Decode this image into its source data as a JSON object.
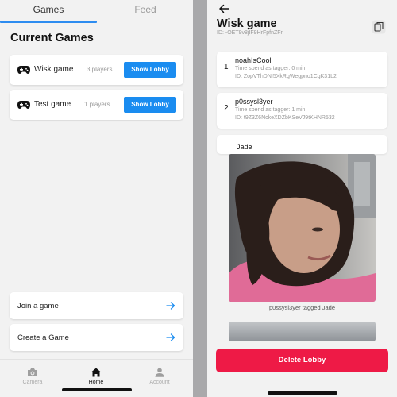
{
  "left": {
    "tabs": [
      {
        "label": "Games",
        "active": true
      },
      {
        "label": "Feed",
        "active": false
      }
    ],
    "section_title": "Current Games",
    "games": [
      {
        "name": "Wisk game",
        "players": "3 players",
        "button": "Show Lobby"
      },
      {
        "name": "Test game",
        "players": "1 players",
        "button": "Show Lobby"
      }
    ],
    "actions": [
      {
        "label": "Join a game",
        "icon": "arrow-right-icon"
      },
      {
        "label": "Create a Game",
        "icon": "arrow-right-icon"
      }
    ],
    "nav": [
      {
        "label": "Camera",
        "icon": "camera-icon",
        "active": false
      },
      {
        "label": "Home",
        "icon": "home-icon",
        "active": true
      },
      {
        "label": "Account",
        "icon": "account-icon",
        "active": false
      }
    ]
  },
  "right": {
    "title": "Wisk game",
    "game_id": "ID: -OET9v8jIF9HrFpfnZFn",
    "players": [
      {
        "num": "1",
        "name": "noahIsCool",
        "time": "Time spend as tagger: 0 min",
        "id": "ID: ZopVThDNI5XkRgWegpno1CgK31L2"
      },
      {
        "num": "2",
        "name": "p0ssysl3yer",
        "time": "Time spend as tagger: 1 min",
        "id": "ID: t9Z3Z6NckeXDZbKSeVJ9tKHNR532"
      }
    ],
    "partial_player": "Jade",
    "feed_caption": "p0ssysl3yer tagged Jade",
    "delete_button": "Delete Lobby"
  },
  "colors": {
    "accent": "#1a8cf0",
    "danger": "#ee1a46",
    "background": "#f2f2f2"
  }
}
